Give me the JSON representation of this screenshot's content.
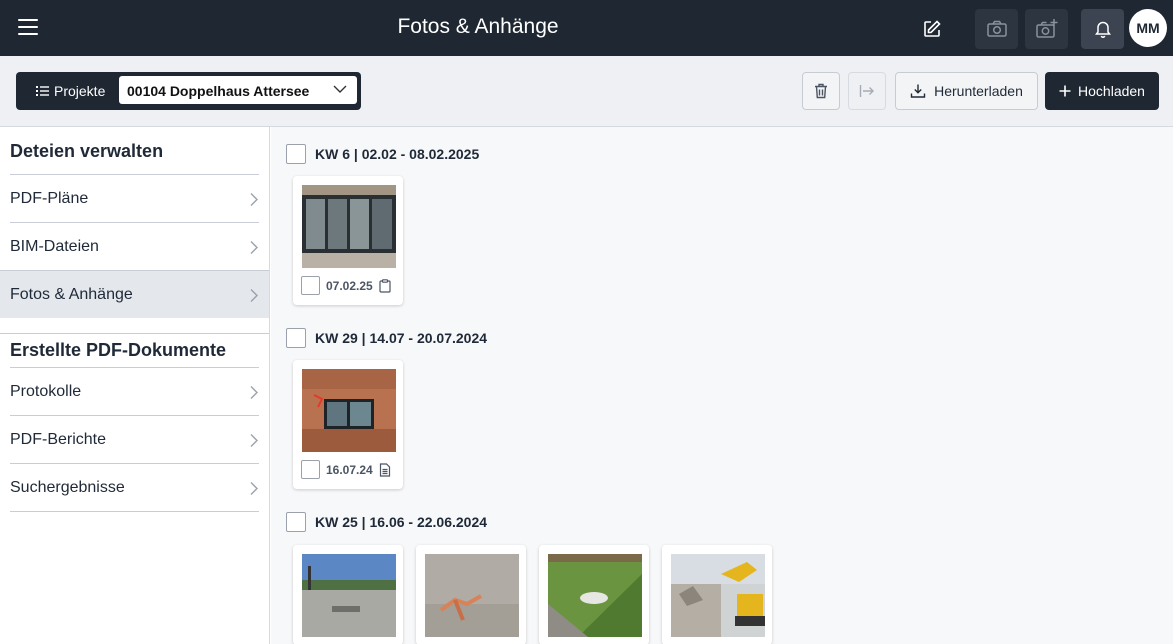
{
  "header": {
    "title": "Fotos & Anhänge",
    "avatar_initials": "MM",
    "icons": [
      "menu-icon",
      "edit-icon",
      "camera-icon",
      "camera-plus-icon",
      "bell-icon"
    ]
  },
  "toolbar": {
    "projects_label": "Projekte",
    "project_selected": "00104 Doppelhaus Attersee",
    "download_label": "Herunterladen",
    "upload_label": "Hochladen"
  },
  "sidebar": {
    "section1_title": "Deteien verwalten",
    "section1_items": [
      {
        "label": "PDF-Pläne"
      },
      {
        "label": "BIM-Dateien"
      },
      {
        "label": "Fotos & Anhänge",
        "active": true
      }
    ],
    "section2_title": "Erstellte PDF-Dokumente",
    "section2_items": [
      {
        "label": "Protokolle"
      },
      {
        "label": "PDF-Berichte"
      },
      {
        "label": "Suchergebnisse"
      }
    ]
  },
  "groups": [
    {
      "title": "KW 6 | 02.02 - 08.02.2025",
      "items": [
        {
          "date": "07.02.25",
          "icon": "clipboard-icon"
        }
      ]
    },
    {
      "title": "KW 29 | 14.07 - 20.07.2024",
      "items": [
        {
          "date": "16.07.24",
          "icon": "document-icon"
        }
      ]
    },
    {
      "title": "KW 25 | 16.06 - 22.06.2024",
      "items": [
        {
          "date": ""
        },
        {
          "date": ""
        },
        {
          "date": ""
        },
        {
          "date": ""
        }
      ]
    }
  ],
  "colors": {
    "topbar_bg": "#1e2732",
    "primary_button": "#1e2732",
    "toolbar_bg": "#eef0f4",
    "active_item_bg": "#e4e7ec"
  }
}
